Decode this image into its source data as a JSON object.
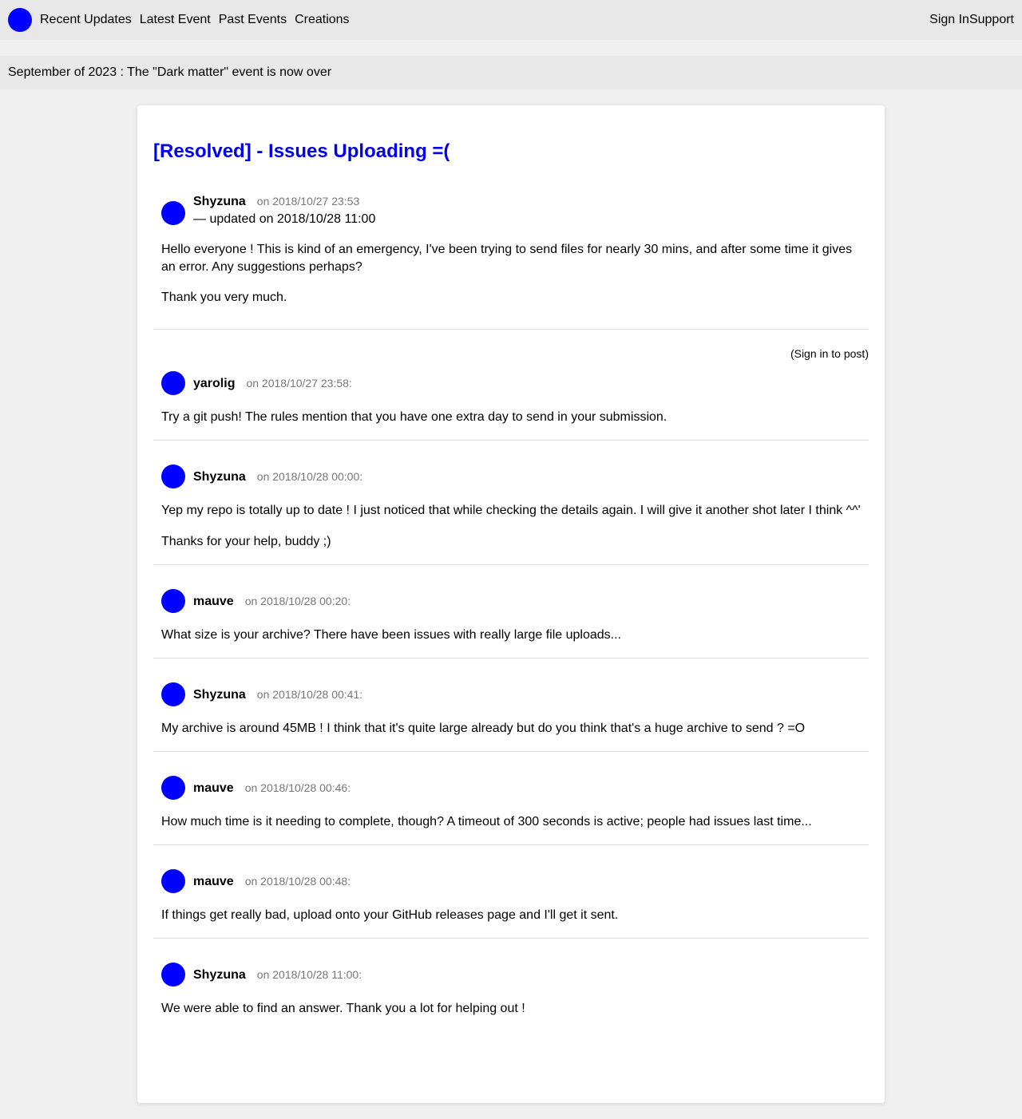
{
  "nav": {
    "items": [
      "Recent Updates",
      "Latest Event",
      "Past Events",
      "Creations"
    ],
    "sign_in": "Sign In",
    "support": "Support"
  },
  "announcement": "September of 2023 : The \"Dark matter\" event is now over",
  "thread": {
    "title": "[Resolved] - Issues Uploading =(",
    "op": {
      "author": "Shyzuna",
      "date": "on 2018/10/27 23:53",
      "updated": "— updated on 2018/10/28 11:00",
      "paragraphs": [
        "Hello everyone ! This is kind of an emergency, I've been trying to send files for nearly 30 mins, and after some time it gives an error. Any suggestions perhaps?",
        "Thank you very much."
      ]
    },
    "signin_note": "(Sign in to post)",
    "replies": [
      {
        "author": "yarolig",
        "date": "on 2018/10/27 23:58:",
        "paragraphs": [
          "Try a git push! The rules mention that you have one extra day to send in your submission."
        ]
      },
      {
        "author": "Shyzuna",
        "date": "on 2018/10/28 00:00:",
        "paragraphs": [
          "Yep my repo is totally up to date ! I just noticed that while checking the details again. I will give it another shot later I think ^^'",
          "Thanks for your help, buddy ;)"
        ]
      },
      {
        "author": "mauve",
        "date": "on 2018/10/28 00:20:",
        "paragraphs": [
          "What size is your archive? There have been issues with really large file uploads..."
        ]
      },
      {
        "author": "Shyzuna",
        "date": "on 2018/10/28 00:41:",
        "paragraphs": [
          "My archive is around 45MB ! I think that it's quite large already but do you think that's a huge archive to send ? =O"
        ]
      },
      {
        "author": "mauve",
        "date": "on 2018/10/28 00:46:",
        "paragraphs": [
          "How much time is it needing to complete, though? A timeout of 300 seconds is active; people had issues last time..."
        ]
      },
      {
        "author": "mauve",
        "date": "on 2018/10/28 00:48:",
        "paragraphs": [
          "If things get really bad, upload onto your GitHub releases page and I'll get it sent."
        ]
      },
      {
        "author": "Shyzuna",
        "date": "on 2018/10/28 11:00:",
        "paragraphs": [
          "We were able to find an answer. Thank you a lot for helping out !"
        ]
      }
    ]
  },
  "colors": {
    "accent": "#0000ff",
    "title": "#0000ee",
    "topbar_bg": "#e8e8e8",
    "page_bg": "#f0f0f0",
    "date": "#777777"
  }
}
